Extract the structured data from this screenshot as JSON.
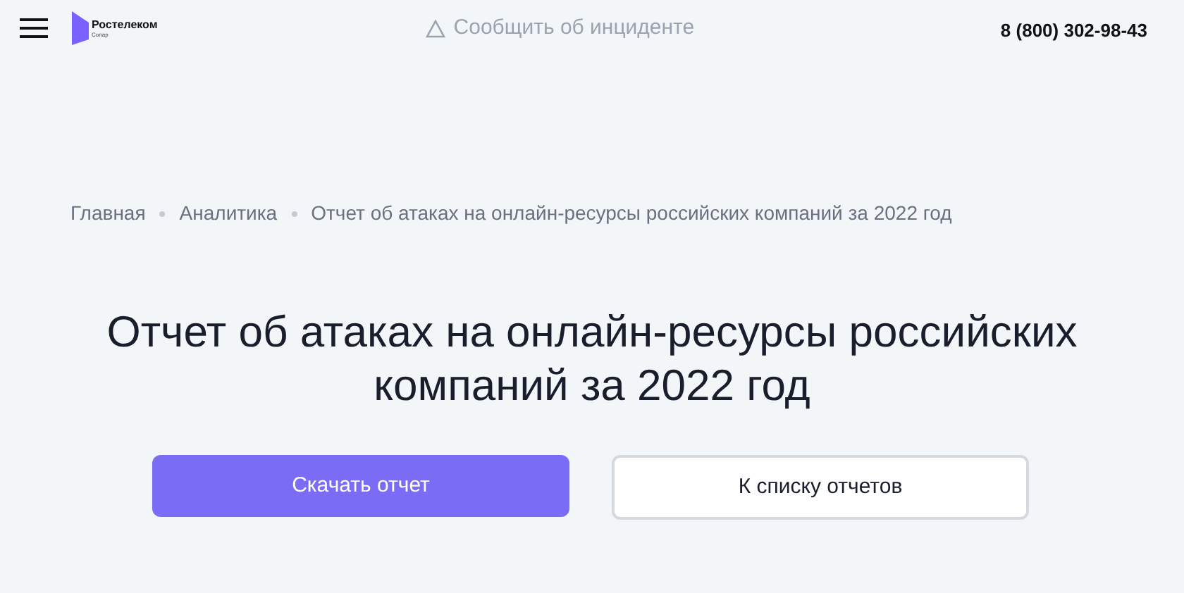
{
  "header": {
    "logo": {
      "name": "Ростелеком",
      "sub": "Солар"
    },
    "report_link": "Сообщить об инциденте",
    "phone": "8 (800) 302-98-43"
  },
  "breadcrumbs": [
    "Главная",
    "Аналитика",
    "Отчет об атаках на онлайн-ресурсы российских компаний за 2022 год"
  ],
  "title": "Отчет об атаках на онлайн-ресурсы российских компаний за 2022 год",
  "buttons": [
    {
      "label": "Скачать отчет",
      "kind": "primary"
    },
    {
      "label": "К списку отчетов",
      "kind": "secondary"
    }
  ]
}
